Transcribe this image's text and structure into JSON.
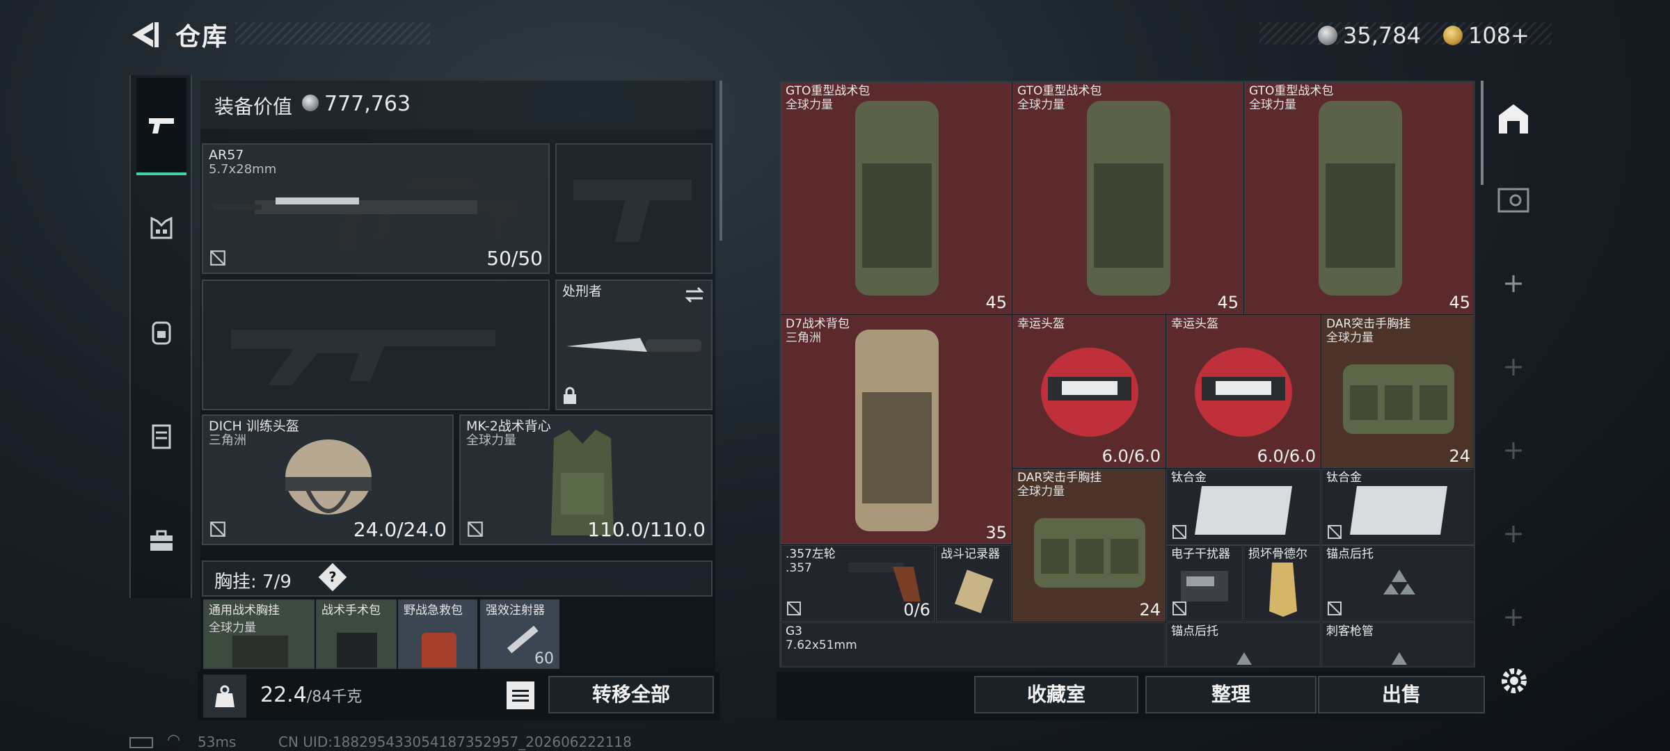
{
  "header": {
    "title": "仓库",
    "currency_silver": "35,784",
    "currency_gold": "108+"
  },
  "equipment": {
    "value_label": "装备价值",
    "value": "777,763",
    "primary": {
      "name": "AR57",
      "ammo_type": "5.7x28mm",
      "ammo": "50/50"
    },
    "melee": {
      "name": "处刑者"
    },
    "helmet": {
      "name": "DICH 训练头盔",
      "faction": "三角洲",
      "durability": "24.0/24.0"
    },
    "armor": {
      "name": "MK-2战术背心",
      "faction": "全球力量",
      "durability": "110.0/110.0"
    },
    "rig_label": "胸挂:",
    "rig_count": "7/9",
    "rig_help": "?",
    "rig_slots": [
      {
        "name": "通用战术胸挂",
        "sub": "全球力量"
      },
      {
        "name": "战术手术包",
        "sub": ""
      },
      {
        "name": "野战急救包",
        "sub": ""
      },
      {
        "name": "强效注射器",
        "sub": "60"
      }
    ],
    "weight": "22.4",
    "weight_max": "/84千克",
    "transfer_all": "转移全部"
  },
  "stash": {
    "items": [
      {
        "name": "GTO重型战术包",
        "sub": "全球力量",
        "qty": "45"
      },
      {
        "name": "GTO重型战术包",
        "sub": "全球力量",
        "qty": "45"
      },
      {
        "name": "GTO重型战术包",
        "sub": "全球力量",
        "qty": "45"
      },
      {
        "name": "D7战术背包",
        "sub": "三角洲",
        "qty": "35"
      },
      {
        "name": "幸运头盔",
        "sub": "",
        "qty": "6.0/6.0"
      },
      {
        "name": "幸运头盔",
        "sub": "",
        "qty": "6.0/6.0"
      },
      {
        "name": "DAR突击手胸挂",
        "sub": "全球力量",
        "qty": "24"
      },
      {
        "name": "DAR突击手胸挂",
        "sub": "全球力量",
        "qty": "24"
      },
      {
        "name": "钛合金",
        "sub": "",
        "qty": ""
      },
      {
        "name": "钛合金",
        "sub": "",
        "qty": ""
      },
      {
        "name": ".357左轮",
        "sub": ".357",
        "qty": "0/6"
      },
      {
        "name": "战斗记录器",
        "sub": "",
        "qty": ""
      },
      {
        "name": "电子干扰器",
        "sub": "",
        "qty": ""
      },
      {
        "name": "损坏骨德尔",
        "sub": "",
        "qty": ""
      },
      {
        "name": "锚点后托",
        "sub": "",
        "qty": ""
      },
      {
        "name": "G3",
        "sub": "7.62x51mm",
        "qty": ""
      },
      {
        "name": "锚点后托",
        "sub": "",
        "qty": ""
      },
      {
        "name": "刺客枪管",
        "sub": "",
        "qty": ""
      }
    ],
    "buttons": {
      "collection": "收藏室",
      "sort": "整理",
      "sell": "出售"
    }
  },
  "status": {
    "ping": "53ms",
    "uid": "CN UID:18829543305418735​2957_202606222118"
  },
  "colors": {
    "accent": "#3fd3a8",
    "red_cell": "#5c2a2c",
    "brown_cell": "#4b3329"
  }
}
